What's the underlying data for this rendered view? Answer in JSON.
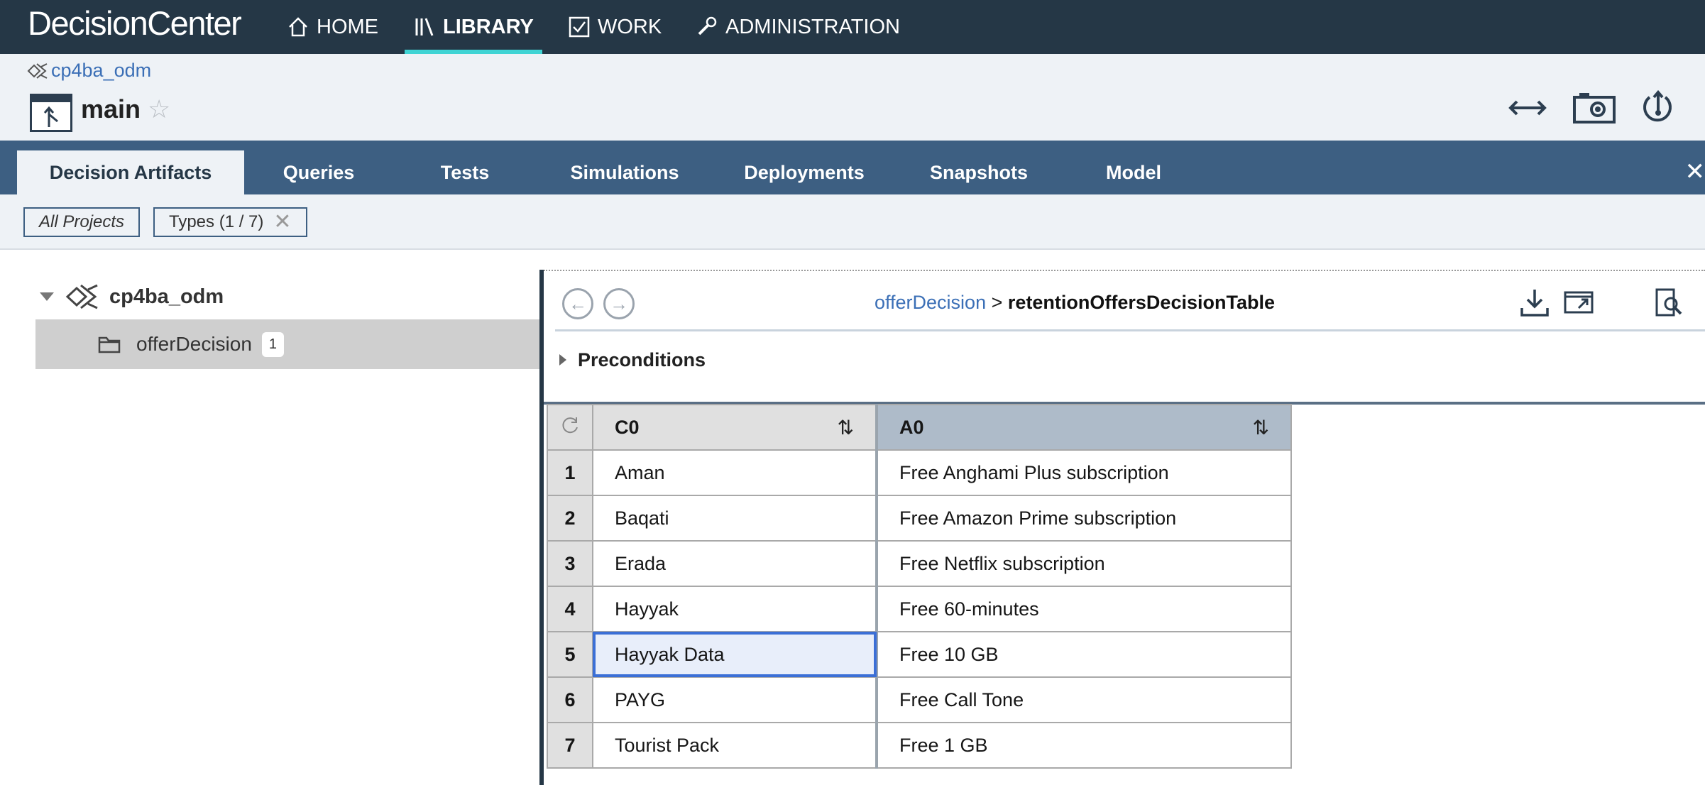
{
  "app": {
    "brand": "DecisionCenter",
    "nav": [
      {
        "label": "HOME",
        "icon": "home-icon"
      },
      {
        "label": "LIBRARY",
        "icon": "library-icon",
        "active": true
      },
      {
        "label": "WORK",
        "icon": "checkbox-icon"
      },
      {
        "label": "ADMINISTRATION",
        "icon": "wrench-icon"
      }
    ],
    "accent_color": "#3fd4d4",
    "navbar_color": "#253746"
  },
  "header": {
    "project_link": "cp4ba_odm",
    "branch": "main",
    "tools": [
      "compare-icon",
      "snapshot-camera-icon",
      "deploy-icon"
    ]
  },
  "tabs": [
    {
      "label": "Decision Artifacts",
      "active": true
    },
    {
      "label": "Queries"
    },
    {
      "label": "Tests"
    },
    {
      "label": "Simulations"
    },
    {
      "label": "Deployments"
    },
    {
      "label": "Snapshots"
    },
    {
      "label": "Model"
    }
  ],
  "filters": {
    "all_projects": "All Projects",
    "types": "Types (1 / 7)"
  },
  "tree": {
    "root": "cp4ba_odm",
    "child": {
      "label": "offerDecision",
      "badge": "1"
    }
  },
  "editor": {
    "crumb_parent": "offerDecision",
    "crumb_sep": ">",
    "crumb_current": "retentionOffersDecisionTable",
    "preconditions": "Preconditions",
    "tools": [
      "download-icon",
      "open-window-icon",
      "search-document-icon"
    ]
  },
  "table": {
    "columns": [
      "C0",
      "A0"
    ],
    "rows": [
      {
        "num": "1",
        "c0": "Aman",
        "a0": "Free Anghami Plus subscription"
      },
      {
        "num": "2",
        "c0": "Baqati",
        "a0": "Free Amazon Prime subscription"
      },
      {
        "num": "3",
        "c0": "Erada",
        "a0": "Free Netflix subscription"
      },
      {
        "num": "4",
        "c0": "Hayyak",
        "a0": "Free 60-minutes"
      },
      {
        "num": "5",
        "c0": "Hayyak Data",
        "a0": "Free 10 GB",
        "selected": true
      },
      {
        "num": "6",
        "c0": "PAYG",
        "a0": "Free Call Tone"
      },
      {
        "num": "7",
        "c0": "Tourist Pack",
        "a0": "Free 1 GB"
      }
    ]
  }
}
